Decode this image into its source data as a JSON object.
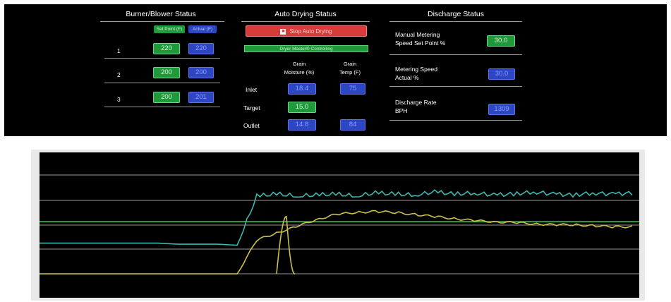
{
  "burner": {
    "title": "Burner/Blower Status",
    "set_point_header": "Set Point (F)",
    "actual_header": "Actual (F)",
    "rows": [
      {
        "label": "1",
        "set_point": "220",
        "actual": "220"
      },
      {
        "label": "2",
        "set_point": "200",
        "actual": "200"
      },
      {
        "label": "3",
        "set_point": "200",
        "actual": "201"
      }
    ]
  },
  "auto_drying": {
    "title": "Auto Drying Status",
    "stop_button": "Stop Auto Drying",
    "status": "Dryer Master® Controlling",
    "moisture_header": "Grain\nMoisture (%)",
    "moisture_header_l1": "Grain",
    "moisture_header_l2": "Moisture (%)",
    "temp_header_l1": "Grain",
    "temp_header_l2": "Temp (F)",
    "inlet_label": "Inlet",
    "inlet_moisture": "18.4",
    "inlet_temp": "75",
    "target_label": "Target",
    "target_moisture": "15.0",
    "outlet_label": "Outlet",
    "outlet_moisture": "14.8",
    "outlet_temp": "84"
  },
  "discharge": {
    "title": "Discharge Status",
    "manual_label_l1": "Manual Metering",
    "manual_label_l2": "Speed Set Point %",
    "manual_value": "30.0",
    "actual_label_l1": "Metering Speed",
    "actual_label_l2": "Actual %",
    "actual_value": "30.0",
    "rate_label_l1": "Discharge Rate",
    "rate_label_l2": "BPH",
    "rate_value": "1309"
  },
  "colors": {
    "teal_line": "#3fb6b0",
    "yellow_line": "#c9c04a",
    "green_target": "#2f9e3f",
    "grid": "#bdbdbd"
  },
  "chart_data": {
    "type": "line",
    "grid": true,
    "series": [
      {
        "values": [
          0.32,
          0.32,
          0.32,
          0.32,
          0.32,
          0.32,
          0.32,
          0.31,
          0.31,
          0.31,
          0.3,
          0.78,
          0.8,
          0.78,
          0.79,
          0.8,
          0.78,
          0.81,
          0.8,
          0.79,
          0.82,
          0.8,
          0.81,
          0.79,
          0.8,
          0.82,
          0.8,
          0.79,
          0.81,
          0.8,
          0.81
        ]
      },
      {
        "values": [
          0.02,
          0.02,
          0.02,
          0.02,
          0.02,
          0.02,
          0.02,
          0.02,
          0.02,
          0.02,
          0.02,
          0.35,
          0.42,
          0.48,
          0.55,
          0.6,
          0.62,
          0.63,
          0.62,
          0.6,
          0.58,
          0.56,
          0.54,
          0.53,
          0.52,
          0.51,
          0.5,
          0.5,
          0.49,
          0.48,
          0.48
        ]
      }
    ],
    "target_line": 0.53
  }
}
